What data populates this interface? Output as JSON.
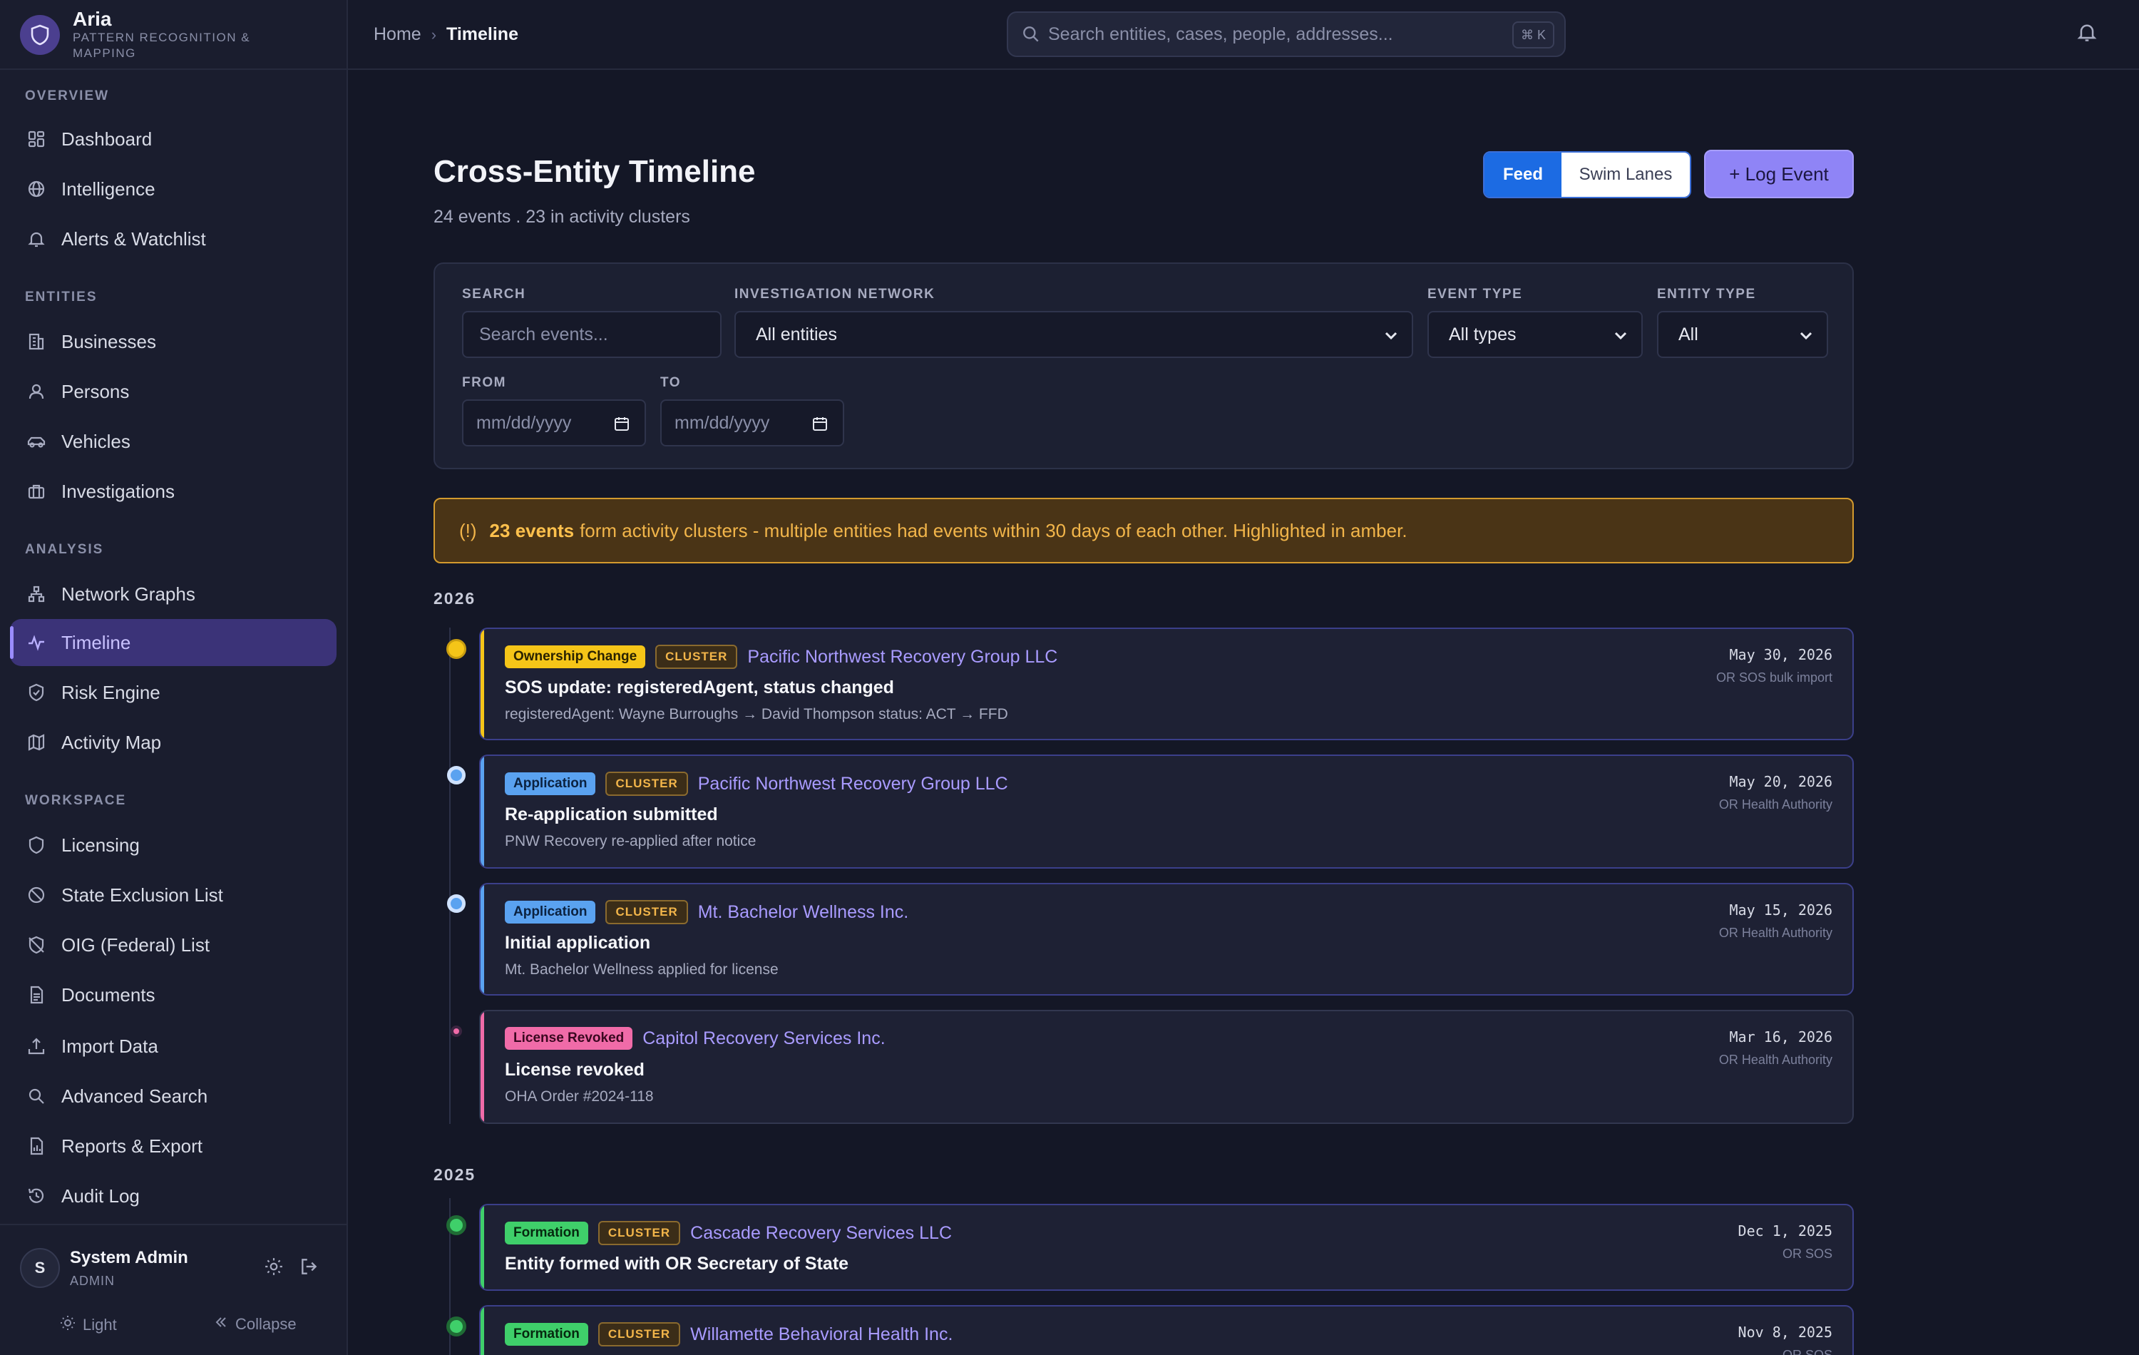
{
  "app": {
    "name": "Aria",
    "subtitle": "PATTERN RECOGNITION & MAPPING"
  },
  "sidebar": {
    "sections": [
      {
        "label": "OVERVIEW"
      },
      {
        "label": "ENTITIES"
      },
      {
        "label": "ANALYSIS"
      },
      {
        "label": "WORKSPACE"
      }
    ],
    "items": [
      {
        "label": "Dashboard",
        "icon": "dashboard-icon"
      },
      {
        "label": "Intelligence",
        "icon": "globe-icon"
      },
      {
        "label": "Alerts & Watchlist",
        "icon": "bell-icon"
      },
      {
        "label": "Businesses",
        "icon": "building-icon"
      },
      {
        "label": "Persons",
        "icon": "person-icon"
      },
      {
        "label": "Vehicles",
        "icon": "car-icon"
      },
      {
        "label": "Investigations",
        "icon": "briefcase-icon"
      },
      {
        "label": "Network Graphs",
        "icon": "network-icon"
      },
      {
        "label": "Timeline",
        "icon": "activity-icon",
        "active": true
      },
      {
        "label": "Risk Engine",
        "icon": "shield-check-icon"
      },
      {
        "label": "Activity Map",
        "icon": "map-icon"
      },
      {
        "label": "Licensing",
        "icon": "shield-icon"
      },
      {
        "label": "State Exclusion List",
        "icon": "ban-icon"
      },
      {
        "label": "OIG (Federal) List",
        "icon": "shield-off-icon"
      },
      {
        "label": "Documents",
        "icon": "document-icon"
      },
      {
        "label": "Import Data",
        "icon": "upload-icon"
      },
      {
        "label": "Advanced Search",
        "icon": "search-icon"
      },
      {
        "label": "Reports & Export",
        "icon": "report-icon"
      },
      {
        "label": "Audit Log",
        "icon": "history-icon"
      }
    ],
    "user": {
      "initial": "S",
      "name": "System Admin",
      "role": "ADMIN"
    },
    "theme_label": "Light",
    "collapse_label": "Collapse"
  },
  "header": {
    "breadcrumb": {
      "home": "Home",
      "separator": "›",
      "current": "Timeline"
    },
    "search": {
      "placeholder": "Search entities, cases, people, addresses...",
      "shortcut": "⌘ K"
    }
  },
  "main": {
    "title": "Cross-Entity Timeline",
    "subtitle": "24 events . 23 in activity clusters",
    "view_toggle": {
      "feed": "Feed",
      "swim_lanes": "Swim Lanes",
      "selected": "Feed"
    },
    "log_event_label": "+ Log Event",
    "filters": {
      "search": {
        "label": "SEARCH",
        "placeholder": "Search events..."
      },
      "network": {
        "label": "INVESTIGATION NETWORK",
        "value": "All entities"
      },
      "event_type": {
        "label": "EVENT TYPE",
        "value": "All types"
      },
      "entity_type": {
        "label": "ENTITY TYPE",
        "value": "All"
      },
      "from": {
        "label": "FROM",
        "placeholder": "mm/dd/yyyy"
      },
      "to": {
        "label": "TO",
        "placeholder": "mm/dd/yyyy"
      }
    },
    "banner": {
      "icon": "(!)",
      "bold": "23 events",
      "text": "form activity clusters - multiple entities had events within 30 days of each other. Highlighted in amber."
    },
    "years": [
      "2026",
      "2025"
    ],
    "events": [
      {
        "badge": "Ownership Change",
        "badge_color": "#f5c518",
        "badge_text_color": "#2a2200",
        "cluster": "CLUSTER",
        "entity": "Pacific Northwest Recovery Group LLC",
        "title": "SOS update: registeredAgent, status changed",
        "desc": "registeredAgent: Wayne Burroughs → David Thompson status: ACT → FFD",
        "date": "May 30, 2026",
        "source": "OR SOS bulk import",
        "accent": "#f5c518"
      },
      {
        "badge": "Application",
        "badge_color": "#5aa2f0",
        "badge_text_color": "#0b2240",
        "cluster": "CLUSTER",
        "entity": "Pacific Northwest Recovery Group LLC",
        "title": "Re-application submitted",
        "desc": "PNW Recovery re-applied after notice",
        "date": "May 20, 2026",
        "source": "OR Health Authority",
        "accent": "#5aa2f0"
      },
      {
        "badge": "Application",
        "badge_color": "#5aa2f0",
        "badge_text_color": "#0b2240",
        "cluster": "CLUSTER",
        "entity": "Mt. Bachelor Wellness Inc.",
        "title": "Initial application",
        "desc": "Mt. Bachelor Wellness applied for license",
        "date": "May 15, 2026",
        "source": "OR Health Authority",
        "accent": "#5aa2f0"
      },
      {
        "badge": "License Revoked",
        "badge_color": "#f06ba8",
        "badge_text_color": "#3a0820",
        "cluster": "",
        "entity": "Capitol Recovery Services Inc.",
        "title": "License revoked",
        "desc": "OHA Order #2024-118",
        "date": "Mar 16, 2026",
        "source": "OR Health Authority",
        "accent": "#f06ba8"
      },
      {
        "badge": "Formation",
        "badge_color": "#3fcf6a",
        "badge_text_color": "#06280f",
        "cluster": "CLUSTER",
        "entity": "Cascade Recovery Services LLC",
        "title": "Entity formed with OR Secretary of State",
        "desc": "",
        "date": "Dec 1, 2025",
        "source": "OR SOS",
        "accent": "#3fcf6a"
      },
      {
        "badge": "Formation",
        "badge_color": "#3fcf6a",
        "badge_text_color": "#06280f",
        "cluster": "CLUSTER",
        "entity": "Willamette Behavioral Health Inc.",
        "title": "",
        "desc": "",
        "date": "Nov 8, 2025",
        "source": "OR SOS",
        "accent": "#3fcf6a"
      }
    ]
  }
}
